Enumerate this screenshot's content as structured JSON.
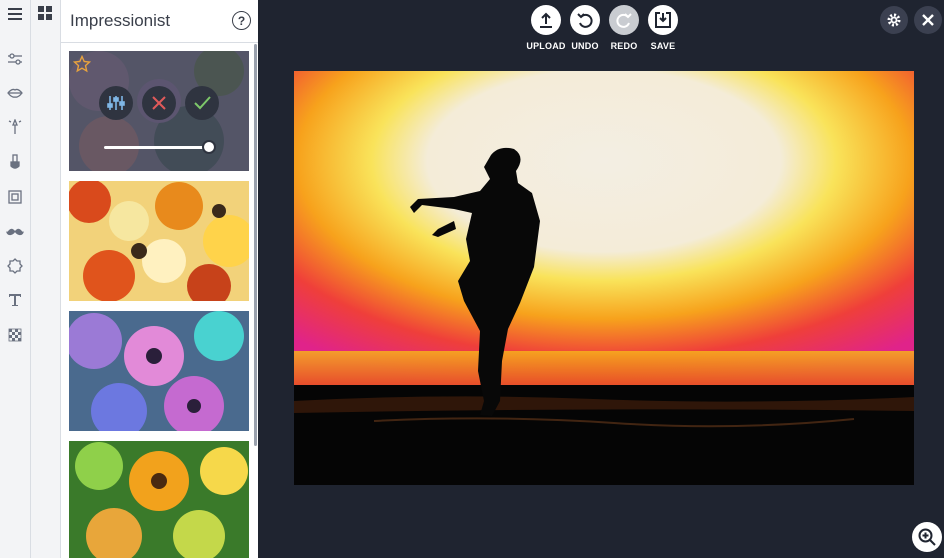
{
  "panel": {
    "title": "Impressionist",
    "help_label": "?"
  },
  "toolbar": {
    "upload_label": "UPLOAD",
    "undo_label": "UNDO",
    "redo_label": "REDO",
    "save_label": "SAVE"
  },
  "rail_icons": [
    "menu-icon",
    "adjust-icon",
    "lips-icon",
    "magic-wand-icon",
    "paint-brush-icon",
    "frame-icon",
    "mustache-icon",
    "badge-icon",
    "text-icon",
    "texture-icon"
  ],
  "effect": {
    "intensity_percent": 95,
    "favorite": false
  },
  "colors": {
    "accent": "#e8a33d",
    "workspace_bg": "#1f2430",
    "panel_bg": "#ffffff"
  }
}
